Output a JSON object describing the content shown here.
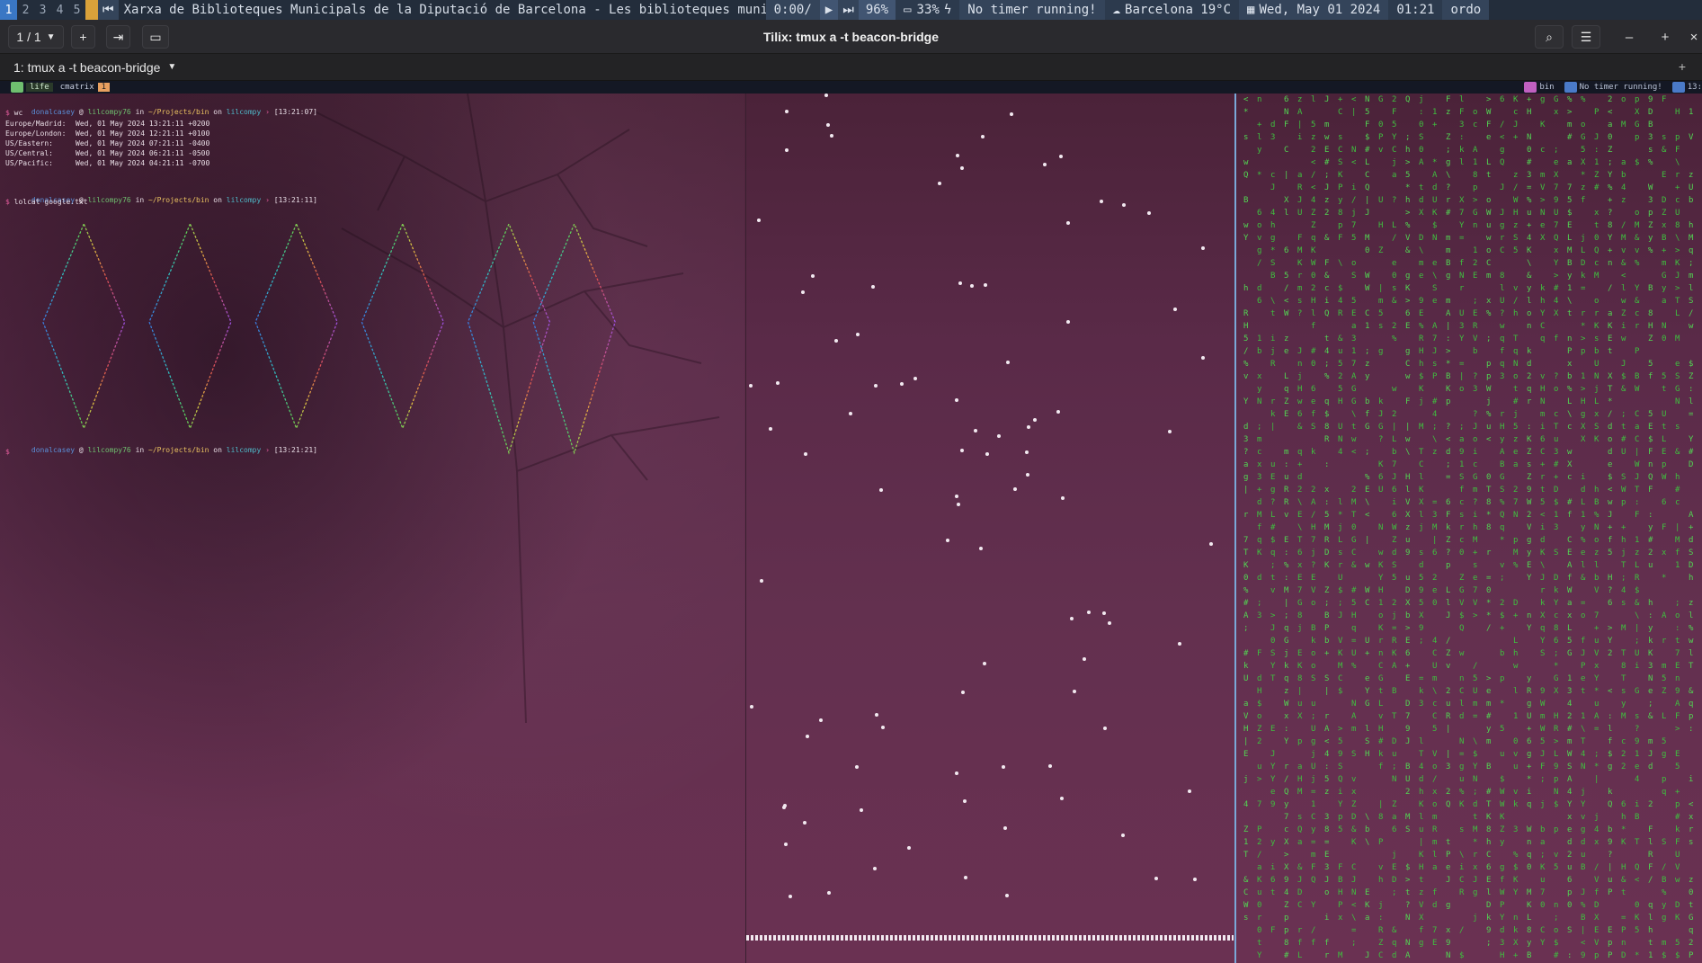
{
  "topbar": {
    "workspaces": [
      "1",
      "2",
      "3",
      "4",
      "5"
    ],
    "active_workspace": "1",
    "media_title": "Xarxa de Biblioteques Municipals de la Diputació de Barcelona - Les biblioteques municipals a les teves mans",
    "media_time": "0:00/",
    "volume": "96%",
    "battery": "33%",
    "timer": "No timer running!",
    "weather": "Barcelona 19°C",
    "date": "Wed, May 01 2024",
    "time": "01:21",
    "user": "ordo",
    "accent": "#3a77c4"
  },
  "header": {
    "tab_counter": "1 / 1",
    "title": "Tilix: tmux a -t beacon-bridge"
  },
  "session": {
    "label": "1: tmux a -t beacon-bridge"
  },
  "tmux": {
    "windows": [
      {
        "label": "life",
        "color": "#6fbf6f"
      },
      {
        "label": "cmatrix",
        "color": "#e8a060",
        "index": "1"
      }
    ],
    "right": [
      {
        "label": "bin",
        "color": "#c060c0"
      },
      {
        "label": "No timer running!",
        "color": "#4a7ac8"
      },
      {
        "label": "13:",
        "color": "#4a7ac8"
      }
    ]
  },
  "terminal": {
    "prompt1": {
      "user": "donalcasey",
      "host": "lilcompy76",
      "dir": "~/Projects/bin",
      "branch": "lilcompy",
      "time": "[13:21:07]"
    },
    "cmd1": "wc",
    "worldclock": [
      {
        "zone": "Europe/Madrid:",
        "value": "Wed, 01 May 2024 13:21:11 +0200"
      },
      {
        "zone": "Europe/London:",
        "value": "Wed, 01 May 2024 12:21:11 +0100"
      },
      {
        "zone": "US/Eastern:",
        "value": "Wed, 01 May 2024 07:21:11 -0400"
      },
      {
        "zone": "US/Central:",
        "value": "Wed, 01 May 2024 06:21:11 -0500"
      },
      {
        "zone": "US/Pacific:",
        "value": "Wed, 01 May 2024 04:21:11 -0700"
      }
    ],
    "prompt2": {
      "user": "donalcasey",
      "host": "lilcompy76",
      "dir": "~/Projects/bin",
      "branch": "lilcompy",
      "time": "[13:21:11]"
    },
    "cmd2": "lolcat google.txt",
    "prompt3": {
      "user": "donalcasey",
      "host": "lilcompy76",
      "dir": "~/Projects/bin",
      "branch": "lilcompy",
      "time": "[13:21:21]"
    },
    "words": {
      "at": "@",
      "in": "in",
      "on": "on",
      "sep": "›",
      "dollar": "$"
    }
  }
}
